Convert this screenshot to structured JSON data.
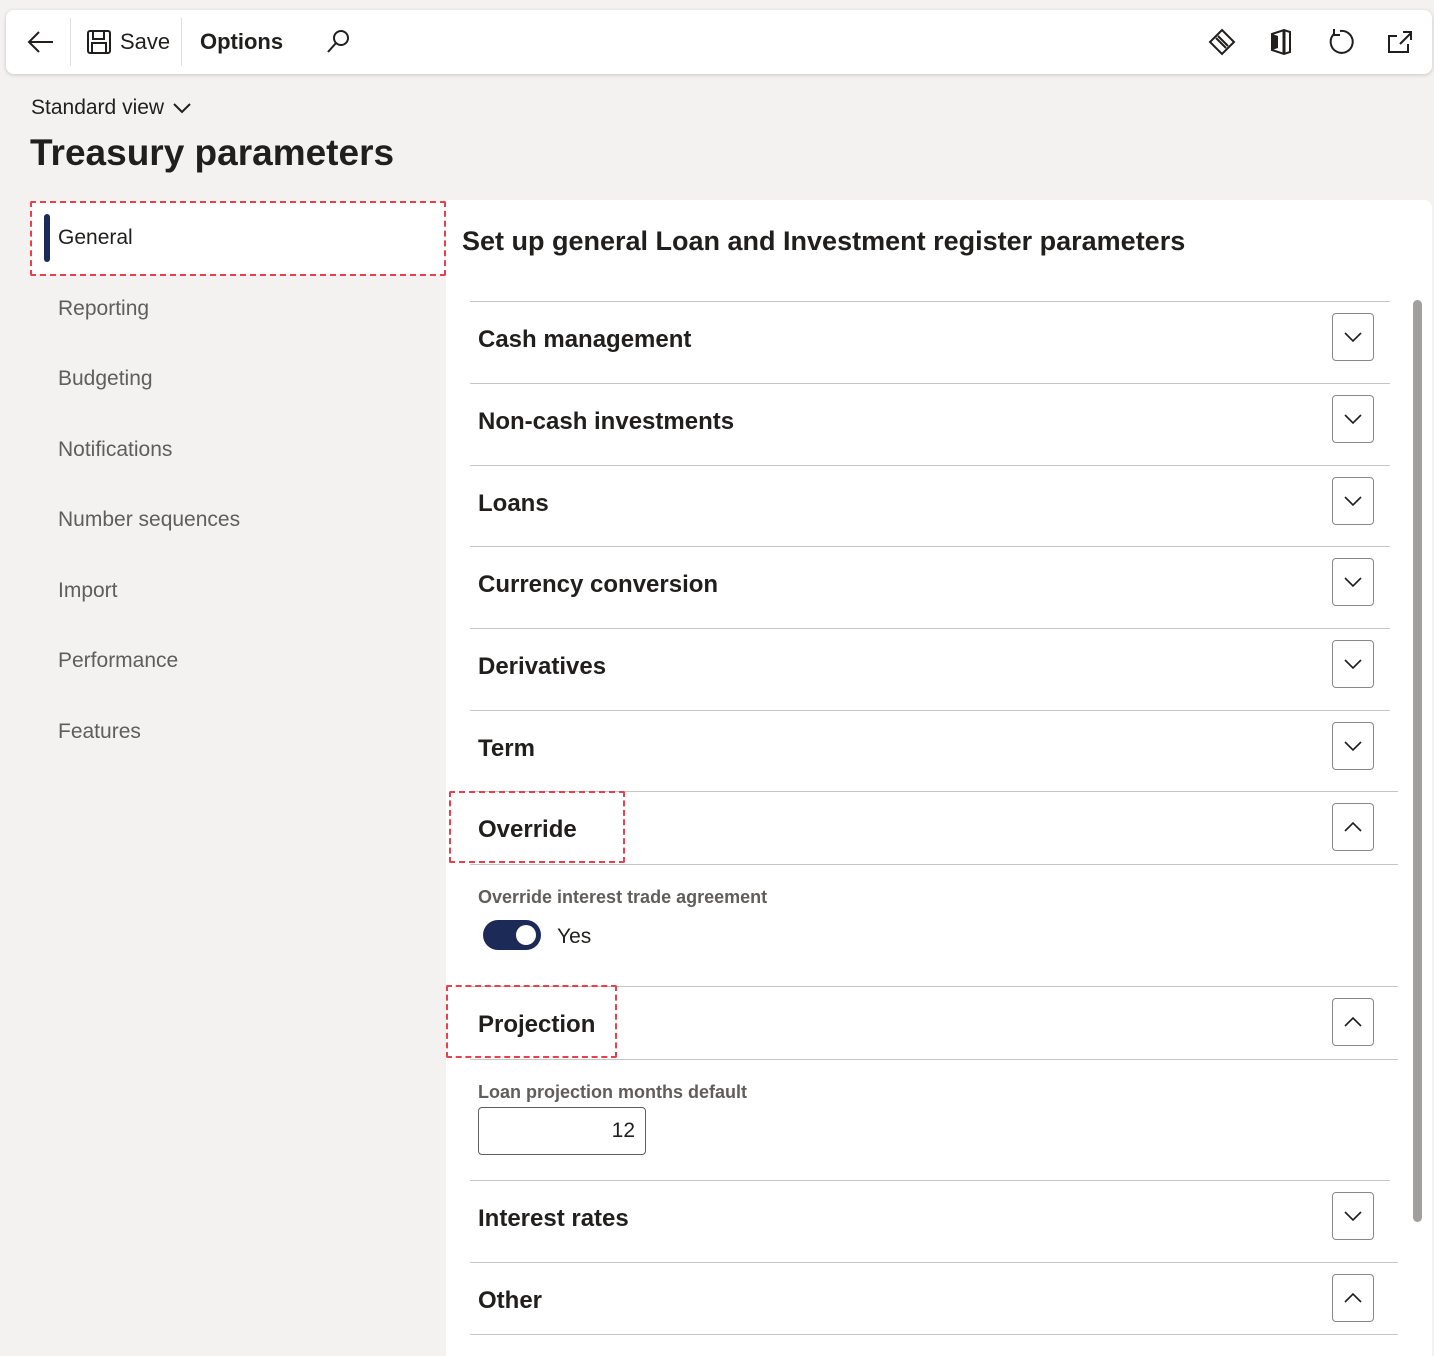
{
  "toolbar": {
    "save_label": "Save",
    "options_label": "Options"
  },
  "header": {
    "view_label": "Standard view",
    "title": "Treasury parameters"
  },
  "nav": {
    "items": [
      {
        "label": "General"
      },
      {
        "label": "Reporting"
      },
      {
        "label": "Budgeting"
      },
      {
        "label": "Notifications"
      },
      {
        "label": "Number sequences"
      },
      {
        "label": "Import"
      },
      {
        "label": "Performance"
      },
      {
        "label": "Features"
      }
    ]
  },
  "main": {
    "heading": "Set up general Loan and Investment register parameters",
    "sections": [
      {
        "title": "Cash management",
        "expanded": false
      },
      {
        "title": "Non-cash investments",
        "expanded": false
      },
      {
        "title": "Loans",
        "expanded": false
      },
      {
        "title": "Currency conversion",
        "expanded": false
      },
      {
        "title": "Derivatives",
        "expanded": false
      },
      {
        "title": "Term",
        "expanded": false
      },
      {
        "title": "Override",
        "expanded": true
      },
      {
        "title": "Projection",
        "expanded": true
      },
      {
        "title": "Interest rates",
        "expanded": false
      },
      {
        "title": "Other",
        "expanded": true
      }
    ],
    "override": {
      "field_label": "Override interest trade agreement",
      "toggle_value": "Yes",
      "toggle_on": true
    },
    "projection": {
      "field_label": "Loan projection months default",
      "value": "12"
    }
  },
  "colors": {
    "accent": "#1b2a57",
    "highlight": "#e8404d"
  }
}
